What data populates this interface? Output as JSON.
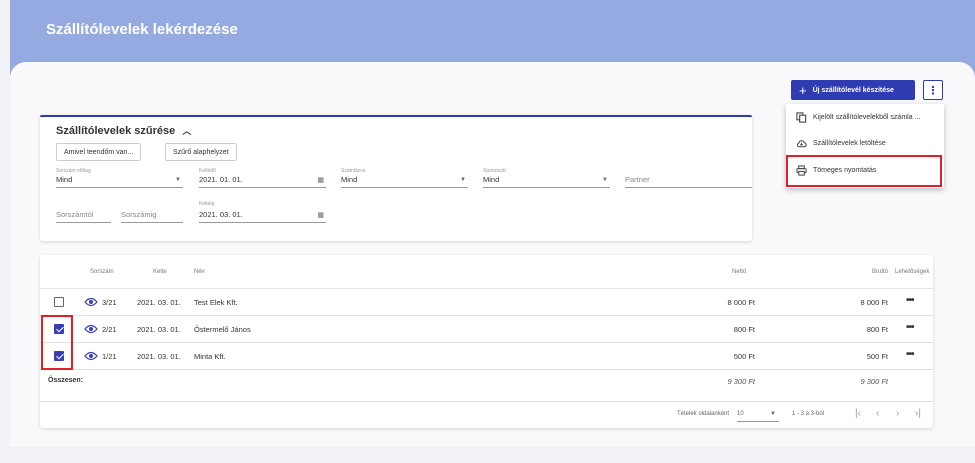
{
  "page_title": "Szállítólevelek lekérdezése",
  "actions": {
    "new_label": "Új szállítólevél készítése",
    "more_label": "⋮"
  },
  "menu": {
    "items": [
      {
        "label": "Kijelölt szállítólevelekből számla ...",
        "icon": "copy-icon"
      },
      {
        "label": "Szállítólevelek letöltése",
        "icon": "cloud-download-icon"
      },
      {
        "label": "Tömeges nyomtatás",
        "icon": "printer-icon"
      }
    ]
  },
  "filter": {
    "title": "Szállítólevelek szűrése",
    "btn_todo": "Amivel teendőm van...",
    "btn_reset": "Szűrő alaphelyzet",
    "prefix_label": "Sorszám előtag",
    "prefix_value": "Mind",
    "from_label": "Keltétől",
    "from_value": "2021. 01. 01.",
    "invoiced_label": "Számlázva",
    "invoiced_value": "Mind",
    "cancelled_label": "Stornózott",
    "cancelled_value": "Mind",
    "partner_placeholder": "Partner",
    "num_from_placeholder": "Sorszámtól",
    "num_to_placeholder": "Sorszámig",
    "to_label": "Keltéig",
    "to_value": "2021. 03. 01."
  },
  "table": {
    "headers": {
      "number": "Sorszám",
      "date": "Kelte",
      "name": "Név",
      "net": "Nettó",
      "gross": "Bruttó",
      "options": "Lehetőségek"
    },
    "rows": [
      {
        "checked": false,
        "number": "3/21",
        "date": "2021. 03. 01.",
        "name": "Test Elek Kft.",
        "net": "8 000 Ft",
        "gross": "8 000 Ft",
        "options": "•••"
      },
      {
        "checked": true,
        "number": "2/21",
        "date": "2021. 03. 01.",
        "name": "Őstermelő János",
        "net": "800 Ft",
        "gross": "800 Ft",
        "options": "•••"
      },
      {
        "checked": true,
        "number": "1/21",
        "date": "2021. 03. 01.",
        "name": "Minta Kft.",
        "net": "500 Ft",
        "gross": "500 Ft",
        "options": "•••"
      }
    ],
    "totals": {
      "label": "Összesen:",
      "net": "9 300 Ft",
      "gross": "9 300 Ft"
    }
  },
  "pager": {
    "per_page_label": "Tételek oldalanként",
    "per_page_value": "10",
    "range": "1 - 3 a 3-ból"
  },
  "colors": {
    "banner": "#94aae0",
    "primary": "#2f3bb0",
    "highlight": "#e3202a"
  }
}
